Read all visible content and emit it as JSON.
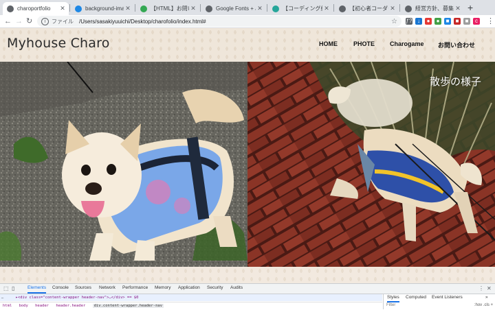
{
  "browser": {
    "tabs": [
      {
        "title": "charoportfolio",
        "color": "#5f6368"
      },
      {
        "title": "background-image - CSS",
        "color": "#1e88e5"
      },
      {
        "title": "【HTML】お問い合わせフォーム",
        "color": "#34a853"
      },
      {
        "title": "Google Fonts + Japanese",
        "color": "#5f6368"
      },
      {
        "title": "【コーディング練習】",
        "color": "#26a69a"
      },
      {
        "title": "【初心者コーダー向け】",
        "color": "#5f6368"
      },
      {
        "title": "経営方針、募集する人材",
        "color": "#5f6368"
      }
    ],
    "scheme_label": "ファイル",
    "url": "/Users/sasakiyuuichi/Desktop/charofolio/index.html#",
    "extensions": [
      {
        "glyph": "ƒ?",
        "color": "#5f6368"
      },
      {
        "glyph": "↓",
        "color": "#1976d2"
      },
      {
        "glyph": "●",
        "color": "#e53935"
      },
      {
        "glyph": "●",
        "color": "#43a047"
      },
      {
        "glyph": "■",
        "color": "#1e88e5"
      },
      {
        "glyph": "■",
        "color": "#c62828"
      },
      {
        "glyph": "■",
        "color": "#9e9e9e"
      },
      {
        "glyph": "c",
        "color": "#e91e63"
      }
    ]
  },
  "site": {
    "logo": "Myhouse Charo",
    "nav": [
      "HOME",
      "PHOTE",
      "Charogame",
      "お問い合わせ"
    ],
    "hero_caption": "散歩の様子"
  },
  "devtools": {
    "tabs": [
      "Elements",
      "Console",
      "Sources",
      "Network",
      "Performance",
      "Memory",
      "Application",
      "Security",
      "Audits"
    ],
    "selected_code": "▸<div class=\"content-wrapper header-nav\">…</div> == $0",
    "breadcrumbs": [
      "html",
      "body",
      "header",
      "header.header",
      "div.content-wrapper.header-nav"
    ],
    "side_tabs": [
      "Styles",
      "Computed",
      "Event Listeners"
    ],
    "filter_placeholder": "Filter",
    "filter_right": ":hov .cls +"
  },
  "colors": {
    "header_bg": "#efe6da",
    "brick": "#7a2b1f"
  }
}
